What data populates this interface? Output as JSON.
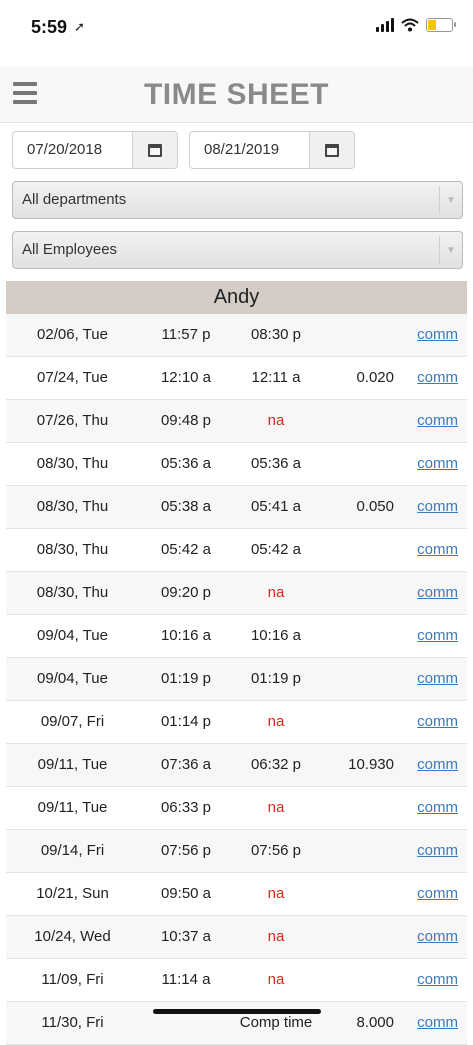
{
  "status_bar": {
    "time": "5:59"
  },
  "header": {
    "title": "TIME SHEET"
  },
  "filters": {
    "start_date": "07/20/2018",
    "end_date": "08/21/2019",
    "department": "All departments",
    "employee": "All Employees"
  },
  "group": {
    "name": "Andy"
  },
  "rows": [
    {
      "date": "02/06, Tue",
      "in": "11:57 p",
      "out": "08:30 p",
      "hours": "",
      "link": "comm"
    },
    {
      "date": "07/24, Tue",
      "in": "12:10 a",
      "out": "12:11 a",
      "hours": "0.020",
      "link": "comm"
    },
    {
      "date": "07/26, Thu",
      "in": "09:48 p",
      "out": "na",
      "hours": "",
      "link": "comm"
    },
    {
      "date": "08/30, Thu",
      "in": "05:36 a",
      "out": "05:36 a",
      "hours": "",
      "link": "comm"
    },
    {
      "date": "08/30, Thu",
      "in": "05:38 a",
      "out": "05:41 a",
      "hours": "0.050",
      "link": "comm"
    },
    {
      "date": "08/30, Thu",
      "in": "05:42 a",
      "out": "05:42 a",
      "hours": "",
      "link": "comm"
    },
    {
      "date": "08/30, Thu",
      "in": "09:20 p",
      "out": "na",
      "hours": "",
      "link": "comm"
    },
    {
      "date": "09/04, Tue",
      "in": "10:16 a",
      "out": "10:16 a",
      "hours": "",
      "link": "comm"
    },
    {
      "date": "09/04, Tue",
      "in": "01:19 p",
      "out": "01:19 p",
      "hours": "",
      "link": "comm"
    },
    {
      "date": "09/07, Fri",
      "in": "01:14 p",
      "out": "na",
      "hours": "",
      "link": "comm"
    },
    {
      "date": "09/11, Tue",
      "in": "07:36 a",
      "out": "06:32 p",
      "hours": "10.930",
      "link": "comm"
    },
    {
      "date": "09/11, Tue",
      "in": "06:33 p",
      "out": "na",
      "hours": "",
      "link": "comm"
    },
    {
      "date": "09/14, Fri",
      "in": "07:56 p",
      "out": "07:56 p",
      "hours": "",
      "link": "comm"
    },
    {
      "date": "10/21, Sun",
      "in": "09:50 a",
      "out": "na",
      "hours": "",
      "link": "comm"
    },
    {
      "date": "10/24, Wed",
      "in": "10:37 a",
      "out": "na",
      "hours": "",
      "link": "comm"
    },
    {
      "date": "11/09, Fri",
      "in": "11:14 a",
      "out": "na",
      "hours": "",
      "link": "comm"
    },
    {
      "date": "11/30, Fri",
      "in": "",
      "out": "Comp time",
      "hours": "8.000",
      "link": "comm"
    }
  ],
  "icons": [
    "location-arrow-icon",
    "cellular-signal-icon",
    "wifi-icon",
    "battery-icon",
    "hamburger-menu-icon",
    "calendar-icon",
    "dropdown-arrow-icon"
  ],
  "colors": {
    "na_text": "#e0271f",
    "link": "#3a7bbf",
    "group_header_bg": "#d3cdc6",
    "title": "#8a8a8a"
  }
}
